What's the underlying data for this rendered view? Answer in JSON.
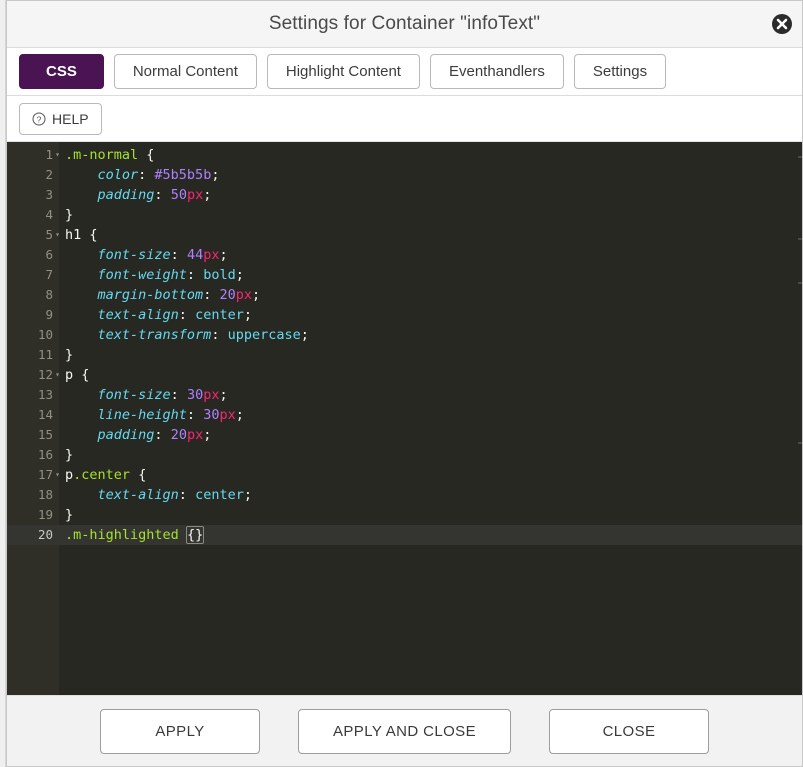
{
  "dialog": {
    "title": "Settings for Container \"infoText\"",
    "close_icon": "close-circle-icon"
  },
  "tabs": [
    {
      "label": "CSS",
      "active": true
    },
    {
      "label": "Normal Content",
      "active": false
    },
    {
      "label": "Highlight Content",
      "active": false
    },
    {
      "label": "Eventhandlers",
      "active": false
    },
    {
      "label": "Settings",
      "active": false
    }
  ],
  "toolbar": {
    "help_label": "HELP",
    "help_icon": "question-mark-circle-icon"
  },
  "editor": {
    "language": "css",
    "theme_background": "#272822",
    "gutter_background": "#2f2f28",
    "active_line": 20,
    "cursor_line": 20,
    "cursor_column": 22,
    "total_lines": 20,
    "fold_lines": [
      1,
      5,
      12,
      17
    ],
    "lines": [
      {
        "n": "1",
        "text": ".m-normal {"
      },
      {
        "n": "2",
        "text": "    color: #5b5b5b;"
      },
      {
        "n": "3",
        "text": "    padding: 50px;"
      },
      {
        "n": "4",
        "text": "}"
      },
      {
        "n": "5",
        "text": "h1 {"
      },
      {
        "n": "6",
        "text": "    font-size: 44px;"
      },
      {
        "n": "7",
        "text": "    font-weight: bold;"
      },
      {
        "n": "8",
        "text": "    margin-bottom: 20px;"
      },
      {
        "n": "9",
        "text": "    text-align: center;"
      },
      {
        "n": "10",
        "text": "    text-transform: uppercase;"
      },
      {
        "n": "11",
        "text": "}"
      },
      {
        "n": "12",
        "text": "p {"
      },
      {
        "n": "13",
        "text": "    font-size: 30px;"
      },
      {
        "n": "14",
        "text": "    line-height: 30px;"
      },
      {
        "n": "15",
        "text": "    padding: 20px;"
      },
      {
        "n": "16",
        "text": "}"
      },
      {
        "n": "17",
        "text": "p.center {"
      },
      {
        "n": "18",
        "text": "    text-align: center;"
      },
      {
        "n": "19",
        "text": "}"
      },
      {
        "n": "20",
        "text": ".m-highlighted {}"
      }
    ]
  },
  "footer": {
    "apply_label": "APPLY",
    "apply_and_close_label": "APPLY AND CLOSE",
    "close_label": "CLOSE"
  },
  "colors": {
    "accent_purple": "#4a1452",
    "editor_bg": "#272822",
    "selector_class": "#a6e22e",
    "property": "#66d9ef",
    "number": "#ae81ff",
    "unit": "#f92672"
  }
}
